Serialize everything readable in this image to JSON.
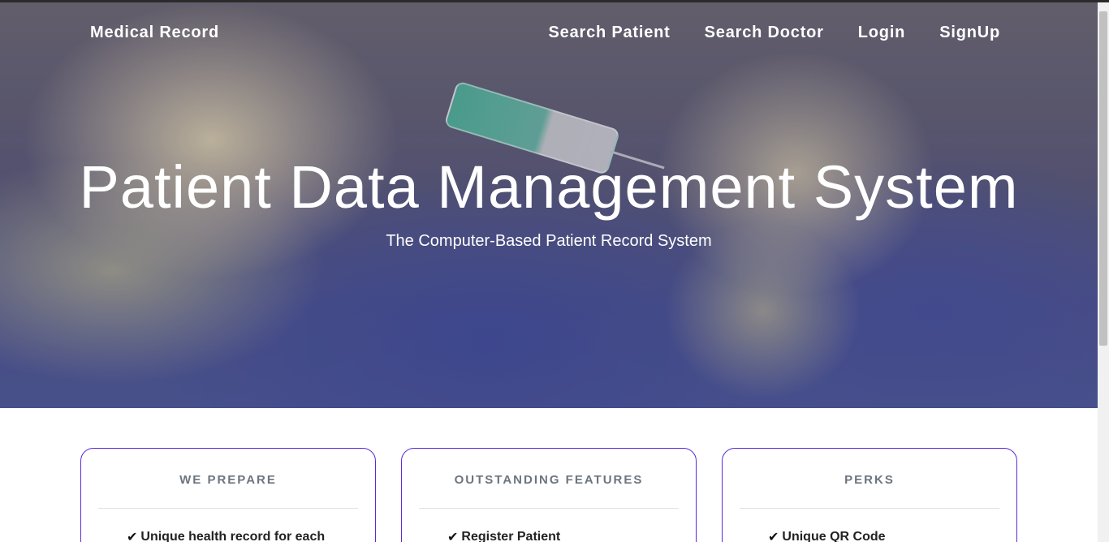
{
  "nav": {
    "brand": "Medical Record",
    "links": [
      "Search Patient",
      "Search Doctor",
      "Login",
      "SignUp"
    ]
  },
  "hero": {
    "title": "Patient Data Management System",
    "subtitle": "The Computer-Based Patient Record System"
  },
  "cards": [
    {
      "title": "WE PREPARE",
      "item": "Unique health record for each"
    },
    {
      "title": "OUTSTANDING FEATURES",
      "item": "Register Patient"
    },
    {
      "title": "PERKS",
      "item": "Unique QR Code"
    }
  ],
  "icons": {
    "check": "check-icon"
  },
  "colors": {
    "card_border": "#5b2bd8",
    "card_title": "#6c757d"
  }
}
